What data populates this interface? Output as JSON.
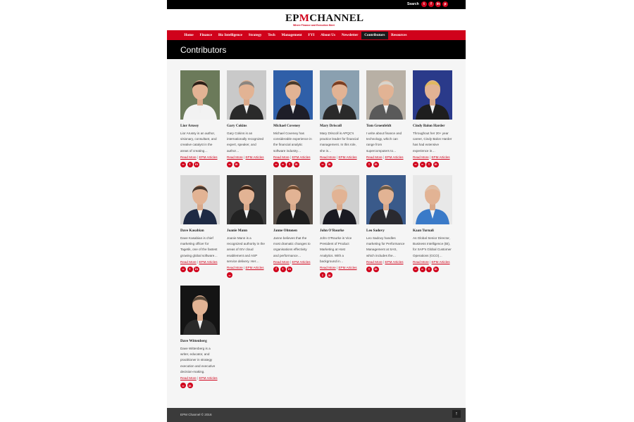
{
  "topbar": {
    "search_label": "Search",
    "socials": [
      {
        "icon": "twitter-icon",
        "glyph": "t"
      },
      {
        "icon": "facebook-icon",
        "glyph": "f"
      },
      {
        "icon": "linkedin-icon",
        "glyph": "in"
      },
      {
        "icon": "pinterest-icon",
        "glyph": "p"
      }
    ]
  },
  "logo": {
    "brand_pre": "EP",
    "brand_mark": "M",
    "brand_post": "CHANNEL",
    "tagline": "Where Finance and Execution Meet"
  },
  "nav": {
    "items": [
      "Home",
      "Finance",
      "Biz Intelligence",
      "Strategy",
      "Tech",
      "Management",
      "FYI",
      "About Us",
      "Newsletter",
      "Contributors",
      "Resources"
    ],
    "active": "Contributors"
  },
  "page_title": "Contributors",
  "link_labels": {
    "read_more": "Read More",
    "separator": "|",
    "articles": "EPM Articles"
  },
  "contributors": [
    {
      "name": "Lior Arussy",
      "bio": "Lior Arussy is an author, visionary, consultant, and creative catalyst in the areas of creating…",
      "icons": [
        "link",
        "twitter",
        "linkedin"
      ],
      "photo_bg": "#6b7a5a",
      "suit": "#f2f2f2",
      "hair": "#2b1e16"
    },
    {
      "name": "Gary Cokins",
      "bio": "Gary Cokins is an internationally recognized expert, speaker, and author…",
      "icons": [
        "link",
        "linkedin"
      ],
      "photo_bg": "#c9c9c9",
      "suit": "#2a2a2a",
      "hair": "#8a8580"
    },
    {
      "name": "Michael Coveney",
      "bio": "Michael Coveney has considerable experience in the financial analytic software industry…",
      "icons": [
        "link",
        "link",
        "twitter",
        "linkedin"
      ],
      "photo_bg": "#2f5fa8",
      "suit": "#1e1e28",
      "hair": "#4a3a2a"
    },
    {
      "name": "Mary Driscoll",
      "bio": "Mary Driscoll is APQC's practice leader for financial management. In this role, she is…",
      "icons": [
        "link",
        "linkedin"
      ],
      "photo_bg": "#8aa0b0",
      "suit": "#2a2a2a",
      "hair": "#7a3e22"
    },
    {
      "name": "Tom Groenfeldt",
      "bio": "I write about finance and technology, which can range from supercomputers to…",
      "icons": [
        "twitter",
        "linkedin"
      ],
      "photo_bg": "#b8b0a5",
      "suit": "#5a5a5a",
      "hair": "#d8d4cc"
    },
    {
      "name": "Cindy Balon Harder",
      "bio": "Throughout her 20+ year career, Cindy Balon Harder has had extensive experience in…",
      "icons": [
        "link",
        "link",
        "twitter",
        "linkedin"
      ],
      "photo_bg": "#2a3a8a",
      "suit": "#1e1e1e",
      "hair": "#e0b860"
    },
    {
      "name": "Dave Kasabian",
      "bio": "Dave Kasabian is chief marketing officer for Tagetik, one of the fastest growing global software…",
      "icons": [
        "link",
        "twitter",
        "linkedin"
      ],
      "photo_bg": "#d8d8d8",
      "suit": "#1e2a44",
      "hair": "#4a3a30"
    },
    {
      "name": "Joanie Mann",
      "bio": "Joanie Mann is a recognized authority in the areas of ISV cloud enablement and ASP service delivery. Her…",
      "icons": [
        "link"
      ],
      "photo_bg": "#3a3a3a",
      "suit": "#222",
      "hair": "#3a2418"
    },
    {
      "name": "Janne Ohtonen",
      "bio": "Janne believes that the most dramatic changes to organisations effectivity and performance…",
      "icons": [
        "facebook",
        "twitter",
        "linkedin"
      ],
      "photo_bg": "#5a5048",
      "suit": "#1e1e1e",
      "hair": "#6a4a30"
    },
    {
      "name": "John O'Rourke",
      "bio": "John O'Rourke is Vice President of Product Marketing at Host Analytics. With a background in…",
      "icons": [
        "twitter",
        "linkedin"
      ],
      "photo_bg": "#d0d0d0",
      "suit": "#1a1a22",
      "hair": "#d8c8b8"
    },
    {
      "name": "Leo Sadovy",
      "bio": "Leo Sadovy handles marketing for Performance Management at SAS, which includes the…",
      "icons": [
        "twitter",
        "linkedin"
      ],
      "photo_bg": "#3a5a8a",
      "suit": "#2a2a30",
      "hair": "#6a5a48"
    },
    {
      "name": "Kaan Turnali",
      "bio": "As Global Senior Director, Business Intelligence (BI), for SAP's Global Customer Operations (GCO)…",
      "icons": [
        "link",
        "link",
        "twitter",
        "linkedin"
      ],
      "photo_bg": "#e8e8e8",
      "suit": "#3a7ac8",
      "hair": "#e0c0a8"
    },
    {
      "name": "Dave Wittenberg",
      "bio": "Dave Wittenberg is a writer, educator, and practitioner in strategy execution and executive decision-making.",
      "icons": [
        "link",
        "linkedin"
      ],
      "photo_bg": "#141414",
      "suit": "#2a2a2a",
      "hair": "#5a4a3a"
    }
  ],
  "footer": {
    "copyright": "EPM Channel © 2016",
    "totop_glyph": "↑"
  }
}
